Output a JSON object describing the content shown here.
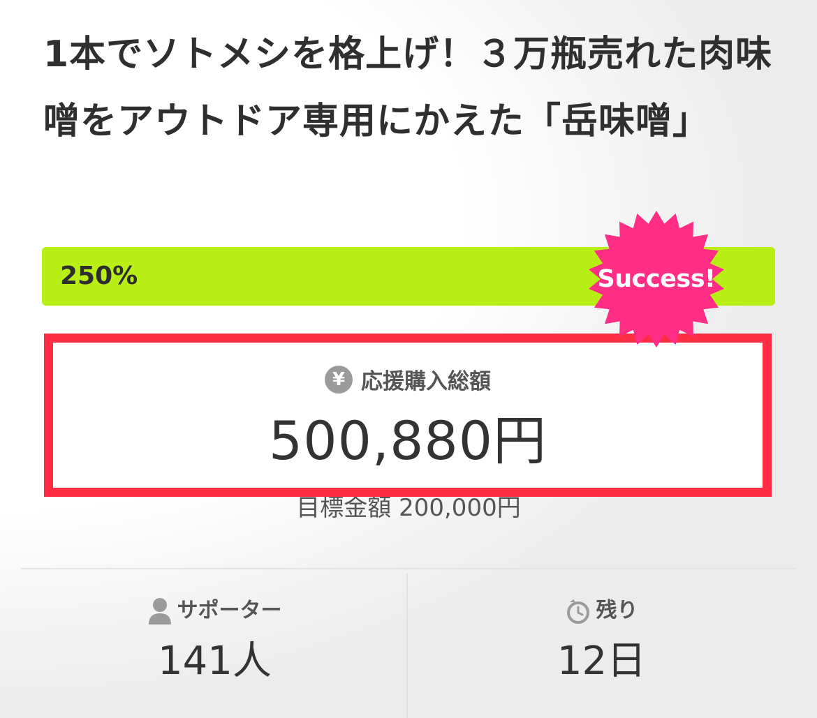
{
  "project": {
    "title": "1本でソトメシを格上げ！３万瓶売れた肉味噌をアウトドア専用にかえた「岳味噌」"
  },
  "progress": {
    "label": "250%",
    "percent": 250,
    "bar_color": "#b7ef17"
  },
  "badge": {
    "text": "Success!",
    "color": "#ff2d84"
  },
  "funding": {
    "icon": "yen-icon",
    "label": "応援購入総額",
    "amount": "500,880円",
    "goal": "目標金額 200,000円",
    "highlight_color": "#ff2d43"
  },
  "stats": {
    "supporters": {
      "icon": "person-icon",
      "label": "サポーター",
      "value": "141人"
    },
    "remaining": {
      "icon": "timer-icon",
      "label": "残り",
      "value": "12日"
    }
  }
}
